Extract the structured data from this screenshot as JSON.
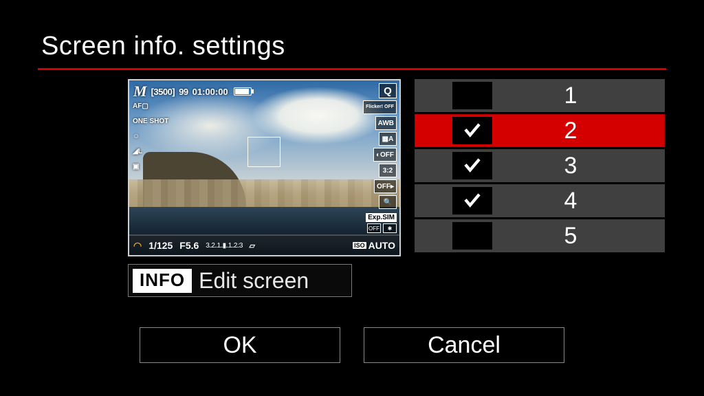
{
  "title": "Screen info. settings",
  "preview": {
    "mode": "M",
    "shots_bracket": "[3500]",
    "shots_remaining": "99",
    "rec_time": "01:00:00",
    "left_icons": {
      "af_mode": "AF▢",
      "drive": "ONE SHOT",
      "face": "☺",
      "quality_flag": "◢L",
      "meter": "▣"
    },
    "right_icons": {
      "q": "Q",
      "flicker": "Flicker! OFF",
      "awb": "AWB",
      "picstyle": "▦A",
      "noise": "◐OFF",
      "aspect": "3:2",
      "touchshutter": "OFF▸",
      "magnify": "🔍"
    },
    "expsim": "Exp.SIM",
    "wifi": "OFF",
    "bt": "✱",
    "shutter": "1/125",
    "aperture": "F5.6",
    "exp_scale": "3..2..1..▮..1..2.:3",
    "flash_comp": "▱",
    "iso_label": "ISO",
    "iso_value": "AUTO"
  },
  "edit_bar": {
    "info_label": "INFO",
    "text": "Edit screen"
  },
  "options": [
    {
      "num": "1",
      "checked": false,
      "selected": false
    },
    {
      "num": "2",
      "checked": true,
      "selected": true
    },
    {
      "num": "3",
      "checked": true,
      "selected": false
    },
    {
      "num": "4",
      "checked": true,
      "selected": false
    },
    {
      "num": "5",
      "checked": false,
      "selected": false
    }
  ],
  "buttons": {
    "ok": "OK",
    "cancel": "Cancel"
  }
}
